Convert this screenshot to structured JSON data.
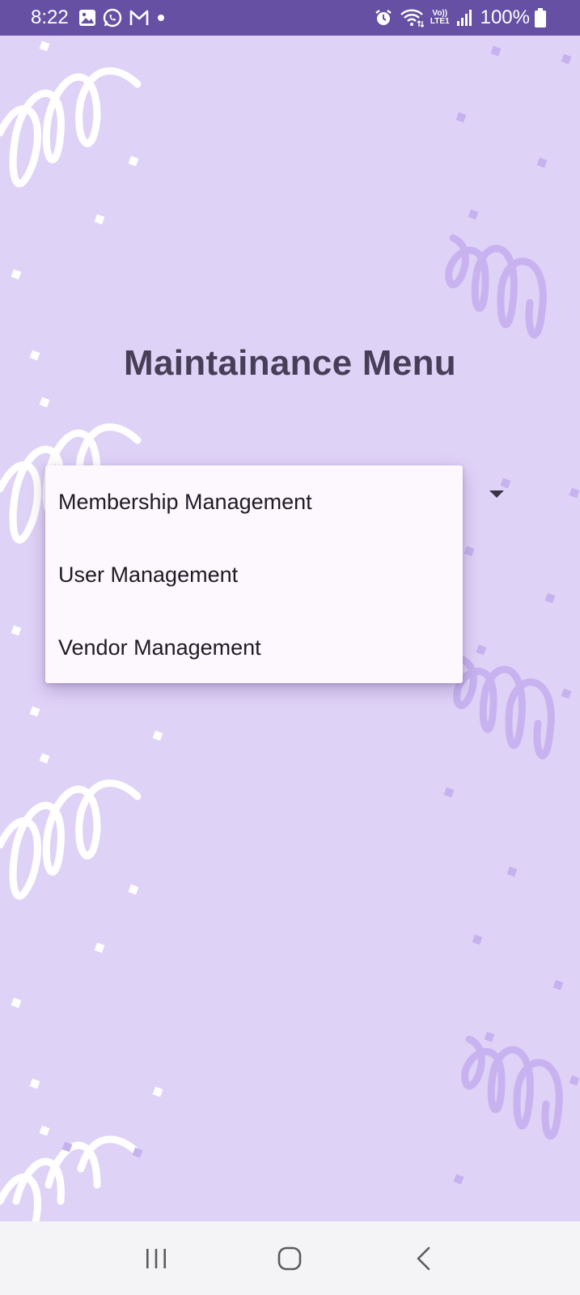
{
  "status_bar": {
    "time": "8:22",
    "battery_percent": "100%",
    "icons_left": [
      "gallery-icon",
      "whatsapp-icon",
      "gmail-icon",
      "dot-icon"
    ],
    "icons_right": [
      "alarm-icon",
      "wifi-icon",
      "volte-icon",
      "signal-icon",
      "battery-icon"
    ],
    "volte_label_top": "Vo))",
    "volte_label_bottom": "LTE1",
    "background_color": "#6550a4"
  },
  "page": {
    "title": "Maintainance Menu",
    "background_color": "#dfd2f7"
  },
  "dropdown": {
    "items": [
      {
        "label": "Membership Management"
      },
      {
        "label": "User Management"
      },
      {
        "label": "Vendor Management"
      }
    ]
  },
  "nav_bar": {
    "buttons": [
      "recents-icon",
      "home-icon",
      "back-icon"
    ]
  }
}
